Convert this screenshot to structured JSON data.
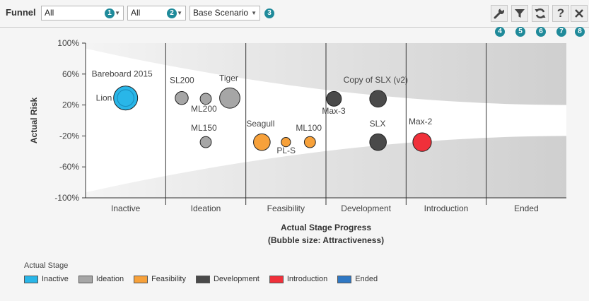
{
  "toolbar": {
    "label": "Funnel",
    "dropdowns": [
      {
        "value": "All",
        "badge": "1"
      },
      {
        "value": "All",
        "badge": "2"
      },
      {
        "value": "Base Scenario",
        "badge": "3"
      }
    ],
    "buttons": [
      {
        "name": "settings-button",
        "icon": "wrench-icon",
        "badge": "4"
      },
      {
        "name": "filter-button",
        "icon": "funnel-icon",
        "badge": "5"
      },
      {
        "name": "refresh-button",
        "icon": "refresh-icon",
        "badge": "6"
      },
      {
        "name": "help-button",
        "icon": "question-icon",
        "badge": "7"
      },
      {
        "name": "close-button",
        "icon": "close-icon",
        "badge": "8"
      }
    ]
  },
  "chart_data": {
    "type": "bubble",
    "xlabel": "Actual Stage Progress",
    "xlabel2": "(Bubble size: Attractiveness)",
    "ylabel": "Actual Risk",
    "categories": [
      "Inactive",
      "Ideation",
      "Feasibility",
      "Development",
      "Introduction",
      "Ended"
    ],
    "ylim": [
      -100,
      100
    ],
    "yticks": [
      "100%",
      "60%",
      "20%",
      "-20%",
      "-60%",
      "-100%"
    ],
    "yticks_values": [
      100,
      60,
      20,
      -20,
      -60,
      -100
    ],
    "points": [
      {
        "label": "Lion",
        "x": 0.5,
        "y": 29,
        "size": 5,
        "stage": "Inactive"
      },
      {
        "label": "Bareboard 2015",
        "x": 0.5,
        "y": 29,
        "size": 3,
        "stage": "Inactive"
      },
      {
        "label": "SL200",
        "x": 1.2,
        "y": 29,
        "size": 2,
        "stage": "Ideation"
      },
      {
        "label": "ML200",
        "x": 1.5,
        "y": 28,
        "size": 1.5,
        "stage": "Ideation"
      },
      {
        "label": "Tiger",
        "x": 1.8,
        "y": 29,
        "size": 4,
        "stage": "Ideation"
      },
      {
        "label": "ML150",
        "x": 1.5,
        "y": -28,
        "size": 1.5,
        "stage": "Ideation"
      },
      {
        "label": "Seagull",
        "x": 2.2,
        "y": -28,
        "size": 3,
        "stage": "Feasibility"
      },
      {
        "label": "PL-S",
        "x": 2.5,
        "y": -28,
        "size": 1,
        "stage": "Feasibility"
      },
      {
        "label": "ML100",
        "x": 2.8,
        "y": -28,
        "size": 1.5,
        "stage": "Feasibility"
      },
      {
        "label": "Max-3",
        "x": 3.1,
        "y": 28,
        "size": 2.5,
        "stage": "Development"
      },
      {
        "label": "Copy of SLX (v2)",
        "x": 3.65,
        "y": 28,
        "size": 3,
        "stage": "Development"
      },
      {
        "label": "SLX",
        "x": 3.65,
        "y": -28,
        "size": 3,
        "stage": "Development"
      },
      {
        "label": "Max-2",
        "x": 4.2,
        "y": -28,
        "size": 3.5,
        "stage": "Introduction"
      }
    ],
    "legend_title": "Actual Stage",
    "legend": [
      {
        "name": "Inactive",
        "color": "#29b6e8"
      },
      {
        "name": "Ideation",
        "color": "#a6a6a6"
      },
      {
        "name": "Feasibility",
        "color": "#f7a13a"
      },
      {
        "name": "Development",
        "color": "#4a4a4a"
      },
      {
        "name": "Introduction",
        "color": "#f0303a"
      },
      {
        "name": "Ended",
        "color": "#2f78c4"
      }
    ]
  }
}
